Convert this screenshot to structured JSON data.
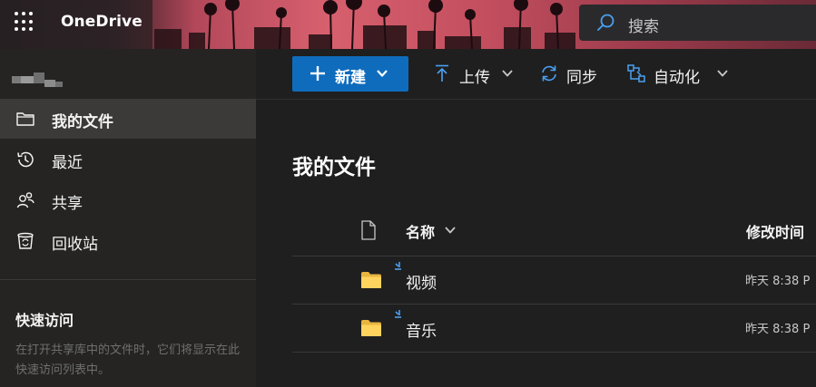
{
  "app": {
    "name": "OneDrive"
  },
  "search": {
    "placeholder": "搜索"
  },
  "sidebar": {
    "items": [
      {
        "label": "我的文件",
        "icon": "folder-icon",
        "active": true
      },
      {
        "label": "最近",
        "icon": "history-icon",
        "active": false
      },
      {
        "label": "共享",
        "icon": "people-icon",
        "active": false
      },
      {
        "label": "回收站",
        "icon": "recycle-bin-icon",
        "active": false
      }
    ],
    "quick_access": {
      "title": "快速访问",
      "description": "在打开共享库中的文件时，它们将显示在此快速访问列表中。"
    }
  },
  "toolbar": {
    "new_label": "新建",
    "upload_label": "上传",
    "sync_label": "同步",
    "automate_label": "自动化"
  },
  "main": {
    "title": "我的文件",
    "columns": {
      "name": "名称",
      "modified": "修改时间"
    },
    "files": [
      {
        "name": "视频",
        "type": "folder",
        "modified": "昨天 8:38 P",
        "is_new": true
      },
      {
        "name": "音乐",
        "type": "folder",
        "modified": "昨天 8:38 P",
        "is_new": true
      }
    ]
  },
  "colors": {
    "accent": "#0f6cbd",
    "icon_blue": "#4ba0f0",
    "folder": "#ffd45e",
    "background": "#1f1f1f",
    "sidebar": "#252423",
    "sidebar_active": "#3b3a39"
  }
}
